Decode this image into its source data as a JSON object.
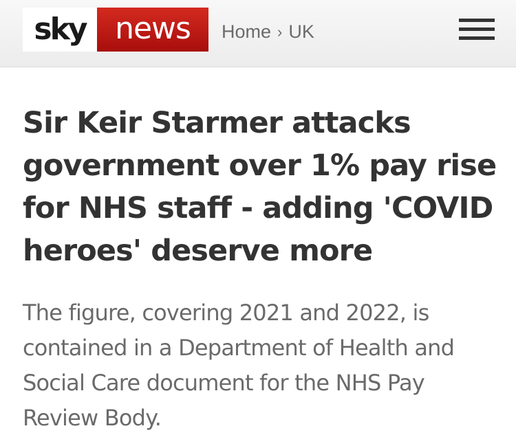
{
  "header": {
    "logo": {
      "sky": "sky",
      "news": "news",
      "colors": {
        "news_red": "#c0160f",
        "sky_text": "#1a1a1a"
      }
    },
    "breadcrumb": {
      "home": "Home",
      "separator": "›",
      "section": "UK"
    },
    "menu_icon": "hamburger-menu-icon"
  },
  "article": {
    "headline": "Sir Keir Starmer attacks government over 1% pay rise for NHS staff - adding 'COVID heroes' deserve more",
    "standfirst": "The figure, covering 2021 and 2022, is contained in a Department of Health and Social Care document for the NHS Pay Review Body."
  }
}
